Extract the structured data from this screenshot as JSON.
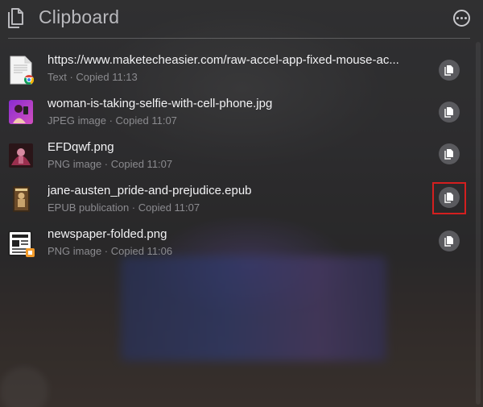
{
  "header": {
    "title": "Clipboard",
    "icon": "clipboard-icon",
    "more_icon": "ellipsis-circle-icon"
  },
  "items": [
    {
      "name": "https://www.maketecheasier.com/raw-accel-app-fixed-mouse-ac...",
      "meta": "Text · Copied 11:13",
      "icon": "document-chrome-icon"
    },
    {
      "name": "woman-is-taking-selfie-with-cell-phone.jpg",
      "meta": "JPEG image · Copied 11:07",
      "icon": "jpeg-thumbnail"
    },
    {
      "name": "EFDqwf.png",
      "meta": "PNG image · Copied 11:07",
      "icon": "png-thumbnail"
    },
    {
      "name": "jane-austen_pride-and-prejudice.epub",
      "meta": "EPUB publication · Copied 11:07",
      "icon": "epub-book-thumbnail"
    },
    {
      "name": "newspaper-folded.png",
      "meta": "PNG image · Copied 11:06",
      "icon": "newspaper-thumbnail"
    }
  ],
  "copy_icon": "copy-icon",
  "colors": {
    "highlight": "#d41f1f",
    "text_primary": "#f2f2f4",
    "text_secondary": "#8b8b8f"
  }
}
